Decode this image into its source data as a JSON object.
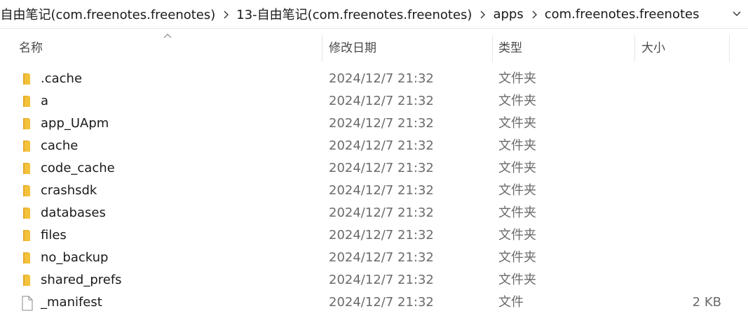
{
  "breadcrumb": {
    "items": [
      "-自由笔记(com.freenotes.freenotes)",
      "13-自由笔记(com.freenotes.freenotes)",
      "apps",
      "com.freenotes.freenotes"
    ]
  },
  "columns": {
    "name": "名称",
    "modified": "修改日期",
    "type": "类型",
    "size": "大小"
  },
  "colors": {
    "folder": "#f3c13a",
    "folder_dark": "#e4a92a",
    "text_secondary": "#6b6b6b"
  },
  "files": [
    {
      "name": ".cache",
      "modified": "2024/12/7 21:32",
      "type": "文件夹",
      "size": "",
      "icon": "folder-icon"
    },
    {
      "name": "a",
      "modified": "2024/12/7 21:32",
      "type": "文件夹",
      "size": "",
      "icon": "folder-icon"
    },
    {
      "name": "app_UApm",
      "modified": "2024/12/7 21:32",
      "type": "文件夹",
      "size": "",
      "icon": "folder-icon"
    },
    {
      "name": "cache",
      "modified": "2024/12/7 21:32",
      "type": "文件夹",
      "size": "",
      "icon": "folder-icon"
    },
    {
      "name": "code_cache",
      "modified": "2024/12/7 21:32",
      "type": "文件夹",
      "size": "",
      "icon": "folder-icon"
    },
    {
      "name": "crashsdk",
      "modified": "2024/12/7 21:32",
      "type": "文件夹",
      "size": "",
      "icon": "folder-icon"
    },
    {
      "name": "databases",
      "modified": "2024/12/7 21:32",
      "type": "文件夹",
      "size": "",
      "icon": "folder-icon"
    },
    {
      "name": "files",
      "modified": "2024/12/7 21:32",
      "type": "文件夹",
      "size": "",
      "icon": "folder-icon"
    },
    {
      "name": "no_backup",
      "modified": "2024/12/7 21:32",
      "type": "文件夹",
      "size": "",
      "icon": "folder-icon"
    },
    {
      "name": "shared_prefs",
      "modified": "2024/12/7 21:32",
      "type": "文件夹",
      "size": "",
      "icon": "folder-icon"
    },
    {
      "name": "_manifest",
      "modified": "2024/12/7 21:32",
      "type": "文件",
      "size": "2 KB",
      "icon": "file-icon"
    }
  ]
}
